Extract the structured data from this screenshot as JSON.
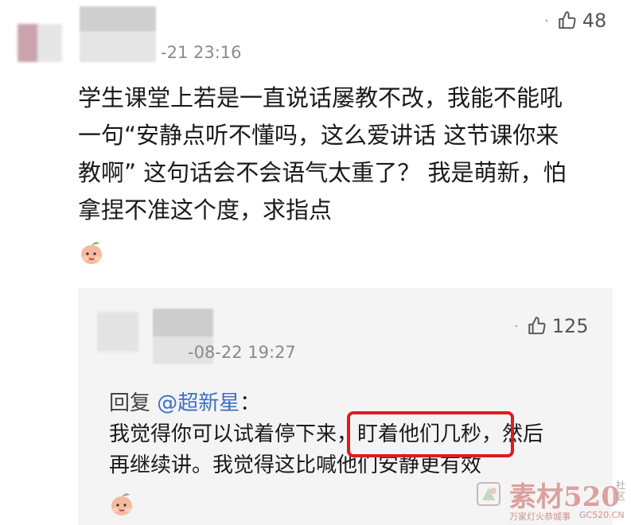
{
  "comment": {
    "timestamp": "-21 23:16",
    "likes": "48",
    "text_lines": [
      "学生课堂上若是一直说话屡教不改，我能不能吼",
      "一句“安静点听不懂吗，这么爱讲话 这节课你来",
      "教啊” 这句话会不会语气太重了？ 我是萌新，怕",
      "拿捏不准这个度，求指点"
    ],
    "emoji": "peach-emoji"
  },
  "reply": {
    "timestamp": "-08-22 19:27",
    "likes": "125",
    "prefix": "回复 ",
    "mention": "@超新星",
    "colon": "：",
    "lines": [
      "我觉得你可以试着停下来，盯着他们几秒，然后",
      "再继续讲。我觉得这比喊他们安静更有效"
    ],
    "emoji": "peach-emoji"
  },
  "watermark": {
    "big": "素材520",
    "small": "万家灯火恭城事",
    "side": "社区",
    "url": "GC520.CN"
  },
  "colors": {
    "accent_link": "#3b6fc4",
    "highlight": "#e11b1b",
    "reply_bg": "#f4f4f4"
  }
}
